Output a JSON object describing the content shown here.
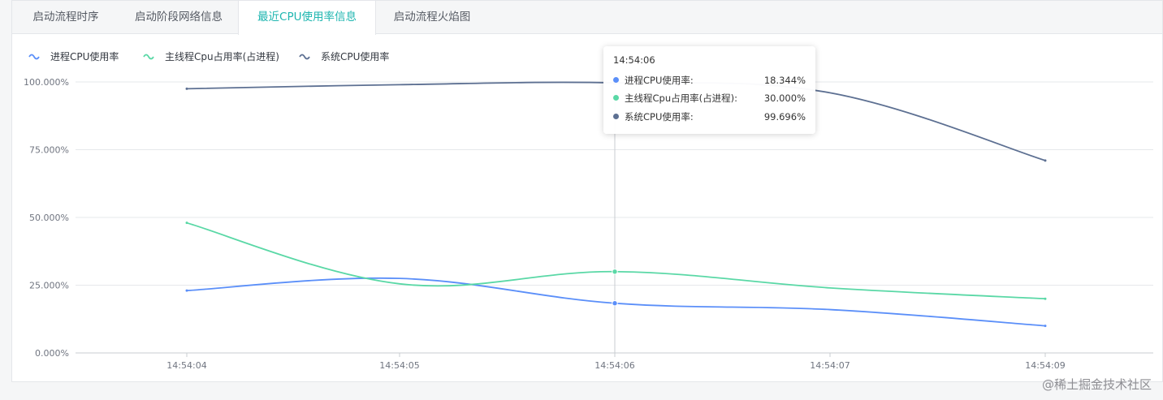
{
  "tabs": [
    {
      "label": "启动流程时序",
      "active": false
    },
    {
      "label": "启动阶段网络信息",
      "active": false
    },
    {
      "label": "最近CPU使用率信息",
      "active": true
    },
    {
      "label": "启动流程火焰图",
      "active": false
    }
  ],
  "colors": {
    "process": "#5b8ff9",
    "main_thread": "#5ad8a6",
    "system": "#5d7092",
    "accent": "#1fb6b0"
  },
  "chart_data": {
    "type": "line",
    "x": [
      "14:54:04",
      "14:54:05",
      "14:54:06",
      "14:54:07",
      "14:54:09"
    ],
    "ylim": [
      0,
      100
    ],
    "y_ticks": [
      "0.000%",
      "25.000%",
      "50.000%",
      "75.000%",
      "100.000%"
    ],
    "grid": true,
    "legend_position": "top-left",
    "series": [
      {
        "name": "进程CPU使用率",
        "color": "#5b8ff9",
        "values": [
          23,
          27.5,
          18.344,
          16,
          10
        ]
      },
      {
        "name": "主线程Cpu占用率(占进程)",
        "color": "#5ad8a6",
        "values": [
          48,
          25.5,
          30.0,
          24,
          20
        ]
      },
      {
        "name": "系统CPU使用率",
        "color": "#5d7092",
        "values": [
          97.5,
          99,
          99.696,
          96,
          71
        ]
      }
    ]
  },
  "tooltip": {
    "title": "14:54:06",
    "rows": [
      {
        "label": "进程CPU使用率:",
        "value": "18.344%",
        "color": "#5b8ff9"
      },
      {
        "label": "主线程Cpu占用率(占进程):",
        "value": "30.000%",
        "color": "#5ad8a6"
      },
      {
        "label": "系统CPU使用率:",
        "value": "99.696%",
        "color": "#5d7092"
      }
    ]
  },
  "watermark": "@稀土掘金技术社区"
}
